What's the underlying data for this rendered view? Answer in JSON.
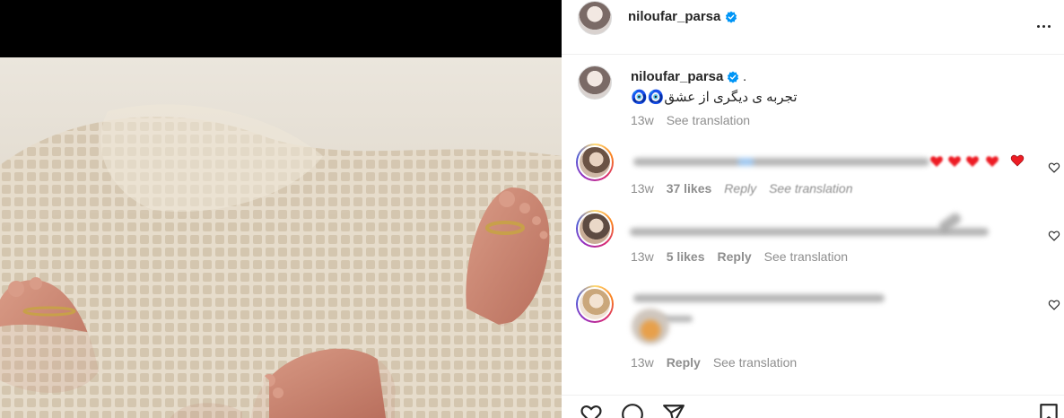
{
  "post": {
    "username": "niloufar_parsa",
    "caption_suffix": ".",
    "caption": "تجربه ی دیگری از عشق🧿🧿",
    "time": "13w",
    "see_translation": "See translation"
  },
  "comments": [
    {
      "time": "13w",
      "likes": "37 likes",
      "reply": "Reply",
      "see_translation": "See translation"
    },
    {
      "time": "13w",
      "likes": "5 likes",
      "reply": "Reply",
      "see_translation": "See translation"
    },
    {
      "time": "13w",
      "reply": "Reply",
      "see_translation": "See translation"
    }
  ],
  "icons": {
    "verified": "verified-badge-icon",
    "more": "more-options-icon",
    "like": "heart-icon",
    "comment": "comment-icon",
    "share": "share-icon",
    "save": "bookmark-icon"
  },
  "colors": {
    "verified": "#0095f6",
    "meta": "#8e8e8e",
    "heart_red": "#ed1c24"
  }
}
